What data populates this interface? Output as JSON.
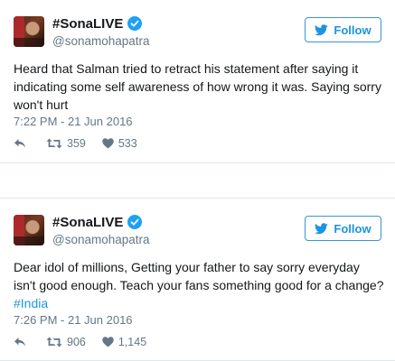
{
  "tweets": [
    {
      "display_name": "#SonaLIVE",
      "handle": "@sonamohapatra",
      "follow_label": "Follow",
      "text_parts": [
        "Heard that Salman tried to retract his statement after saying it indicating some self awareness of how wrong it was. Saying sorry won't hurt"
      ],
      "timestamp": "7:22 PM - 21 Jun 2016",
      "retweets": "359",
      "likes": "533"
    },
    {
      "display_name": "#SonaLIVE",
      "handle": "@sonamohapatra",
      "follow_label": "Follow",
      "text_before": "Dear idol of millions, Getting your father to say sorry everyday isn't good enough. Teach your fans something good for a change? ",
      "hashtag": "#India",
      "timestamp": "7:26 PM - 21 Jun 2016",
      "retweets": "906",
      "likes": "1,145"
    }
  ],
  "colors": {
    "accent": "#1b95e0",
    "muted": "#657786",
    "text": "#14171a",
    "border": "#e1e8ed"
  },
  "icons": {
    "verified": "verified-badge-icon",
    "follow": "twitter-bird-icon",
    "reply": "reply-arrow-icon",
    "retweet": "retweet-icon",
    "like": "heart-icon"
  }
}
